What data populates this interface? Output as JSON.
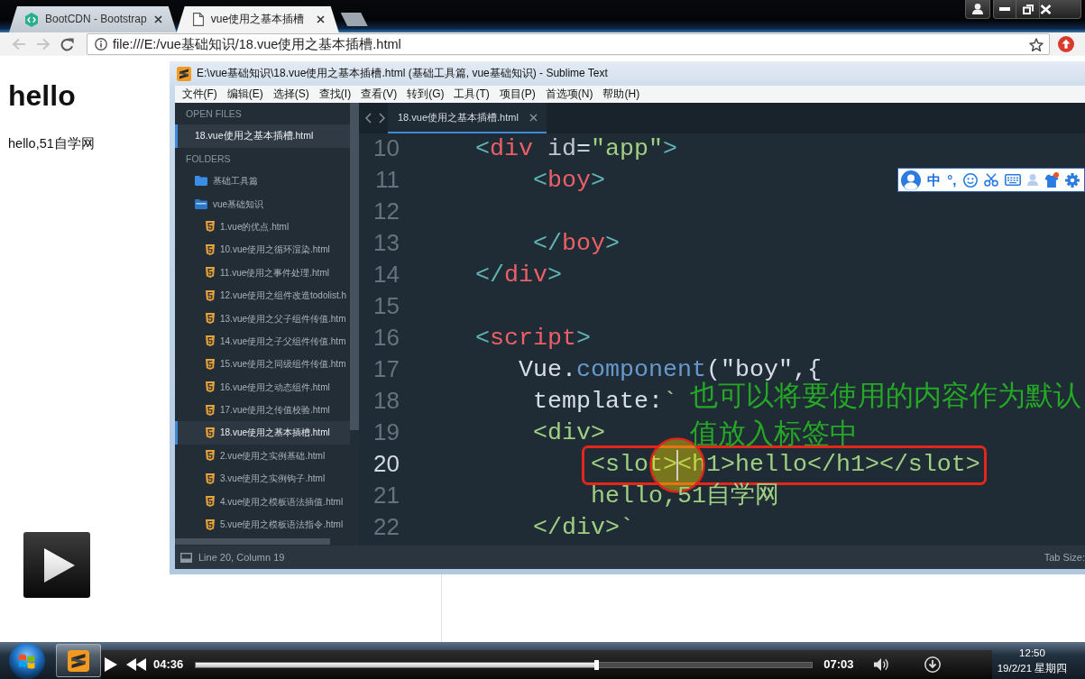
{
  "browser": {
    "tabs": [
      {
        "title": "BootCDN - Bootstrap",
        "selected": false
      },
      {
        "title": "vue使用之基本插槽",
        "selected": true
      }
    ],
    "nav": [
      {
        "kind": "back",
        "disabled": true
      },
      {
        "kind": "forward",
        "disabled": true
      },
      {
        "kind": "reload",
        "disabled": false
      }
    ],
    "address": "file:///E:/vue基础知识/18.vue使用之基本插槽.html",
    "page": {
      "heading": "hello",
      "text": "hello,51自学网"
    }
  },
  "editor_window": {
    "title": "E:\\vue基础知识\\18.vue使用之基本插槽.html (基础工具篇, vue基础知识) - Sublime Text",
    "menu": [
      "文件(F)",
      "编辑(E)",
      "选择(S)",
      "查找(I)",
      "查看(V)",
      "转到(G)",
      "工具(T)",
      "项目(P)",
      "首选项(N)",
      "帮助(H)"
    ],
    "sidebar": {
      "open_files": {
        "title": "OPEN FILES",
        "items": [
          {
            "label": "18.vue使用之基本插槽.html",
            "selected": true
          }
        ]
      },
      "folders": {
        "title": "FOLDERS",
        "items": [
          {
            "label": "基础工具篇",
            "kind": "folder",
            "expanded": false,
            "selected": false
          },
          {
            "label": "vue基础知识",
            "kind": "folder",
            "expanded": true,
            "selected": false,
            "children": [
              {
                "label": "1.vue的优点.html",
                "kind": "file",
                "selected": false
              },
              {
                "label": "10.vue使用之循环渲染.html",
                "kind": "file",
                "selected": false
              },
              {
                "label": "11.vue使用之事件处理.html",
                "kind": "file",
                "selected": false
              },
              {
                "label": "12.vue使用之组件改造todolist.h",
                "kind": "file",
                "selected": false
              },
              {
                "label": "13.vue使用之父子组件传值.htm",
                "kind": "file",
                "selected": false
              },
              {
                "label": "14.vue使用之子父组件传值.htm",
                "kind": "file",
                "selected": false
              },
              {
                "label": "15.vue使用之同级组件传值.htm",
                "kind": "file",
                "selected": false
              },
              {
                "label": "16.vue使用之动态组件.html",
                "kind": "file",
                "selected": false
              },
              {
                "label": "17.vue使用之传值校验.html",
                "kind": "file",
                "selected": false
              },
              {
                "label": "18.vue使用之基本插槽.html",
                "kind": "file",
                "selected": true
              },
              {
                "label": "2.vue使用之实例基础.html",
                "kind": "file",
                "selected": false
              },
              {
                "label": "3.vue使用之实例钩子.html",
                "kind": "file",
                "selected": false
              },
              {
                "label": "4.vue使用之模板语法插值.html",
                "kind": "file",
                "selected": false
              },
              {
                "label": "5.vue使用之模板语法指令.html",
                "kind": "file",
                "selected": false
              }
            ]
          }
        ]
      }
    },
    "tabs": [
      {
        "title": "18.vue使用之基本插槽.html",
        "selected": true
      }
    ],
    "lines": [
      {
        "number": "10",
        "current": false,
        "boxed": false,
        "tokens": [
          {
            "text": "    <",
            "kind": "bracket"
          },
          {
            "text": "div",
            "kind": "tag"
          },
          {
            "text": " id",
            "kind": "attr"
          },
          {
            "text": "=",
            "kind": "plain"
          },
          {
            "text": "\"app\"",
            "kind": "string"
          },
          {
            "text": ">",
            "kind": "bracket"
          }
        ]
      },
      {
        "number": "11",
        "current": false,
        "boxed": false,
        "tokens": [
          {
            "text": "        <",
            "kind": "bracket"
          },
          {
            "text": "boy",
            "kind": "tag"
          },
          {
            "text": ">",
            "kind": "bracket"
          }
        ]
      },
      {
        "number": "12",
        "current": false,
        "boxed": false
      },
      {
        "number": "13",
        "current": false,
        "boxed": false,
        "tokens": [
          {
            "text": "        </",
            "kind": "bracket"
          },
          {
            "text": "boy",
            "kind": "tag"
          },
          {
            "text": ">",
            "kind": "bracket"
          }
        ]
      },
      {
        "number": "14",
        "current": false,
        "boxed": false,
        "tokens": [
          {
            "text": "    </",
            "kind": "bracket"
          },
          {
            "text": "div",
            "kind": "tag"
          },
          {
            "text": ">",
            "kind": "bracket"
          }
        ]
      },
      {
        "number": "15",
        "current": false,
        "boxed": false
      },
      {
        "number": "16",
        "current": false,
        "boxed": false,
        "tokens": [
          {
            "text": "    <",
            "kind": "bracket"
          },
          {
            "text": "script",
            "kind": "tag"
          },
          {
            "text": ">",
            "kind": "bracket"
          }
        ]
      },
      {
        "number": "17",
        "current": false,
        "boxed": false,
        "tokens": [
          {
            "text": "       Vue.",
            "kind": "plain"
          },
          {
            "text": "component",
            "kind": "func"
          },
          {
            "text": "(\"boy\",{",
            "kind": "plain"
          }
        ]
      },
      {
        "number": "18",
        "current": false,
        "boxed": false,
        "tokens": [
          {
            "text": "        template:",
            "kind": "plain"
          },
          {
            "text": "`",
            "kind": "string"
          }
        ]
      },
      {
        "number": "19",
        "current": false,
        "boxed": false,
        "tokens": [
          {
            "text": "        <div>",
            "kind": "string"
          }
        ]
      },
      {
        "number": "20",
        "current": true,
        "boxed": true,
        "tokens": [
          {
            "text": "            <slot><h1>hello</h1></slot>",
            "kind": "string"
          }
        ]
      },
      {
        "number": "21",
        "current": false,
        "boxed": false,
        "tokens": [
          {
            "text": "            hello,51自学网",
            "kind": "string"
          }
        ]
      },
      {
        "number": "22",
        "current": false,
        "boxed": false,
        "tokens": [
          {
            "text": "        </div>`",
            "kind": "string"
          }
        ]
      }
    ],
    "annotation": "也可以将要使用的内容作为默认值放入标签中",
    "ime_toolbar": {
      "mode": "中",
      "punctuation": "°,"
    },
    "status_bar": {
      "position": "Line 20, Column 19",
      "tab_size": "Tab Size:"
    }
  },
  "video_player": {
    "elapsed": "04:36",
    "duration": "07:03",
    "progress": {
      "level": 0.65
    }
  },
  "taskbar": {
    "time": "12:50",
    "date": "19/2/21 星期四"
  }
}
